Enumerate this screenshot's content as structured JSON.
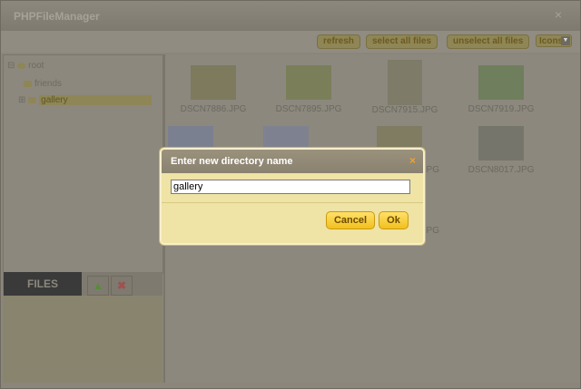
{
  "window": {
    "title": "PHPFileManager",
    "close_icon": "×"
  },
  "toolbar": {
    "refresh": "refresh",
    "select_all": "select all files",
    "unselect_all": "unselect all files",
    "view_mode": "Icons"
  },
  "tree": {
    "root": "root",
    "children": [
      {
        "label": "friends"
      },
      {
        "label": "gallery",
        "selected": true
      }
    ]
  },
  "files_panel": {
    "label": "FILES",
    "upload_icon": "up-arrow-icon",
    "delete_icon": "delete-x-icon"
  },
  "thumbnails": [
    {
      "name": "DSCN7886.JPG"
    },
    {
      "name": "DSCN7895.JPG"
    },
    {
      "name": "DSCN7915.JPG"
    },
    {
      "name": "DSCN7919.JPG"
    },
    {
      "name": ""
    },
    {
      "name": ""
    },
    {
      "name": "...JPG"
    },
    {
      "name": "DSCN8017.JPG"
    },
    {
      "name": "...JPG"
    }
  ],
  "dialog": {
    "title": "Enter new directory name",
    "close_icon": "×",
    "input_value": "gallery",
    "cancel_label": "Cancel",
    "ok_label": "Ok"
  },
  "colors": {
    "accent": "#f2c01e",
    "dialog_bg": "#efe3a5",
    "overlay": "#8c887e"
  }
}
